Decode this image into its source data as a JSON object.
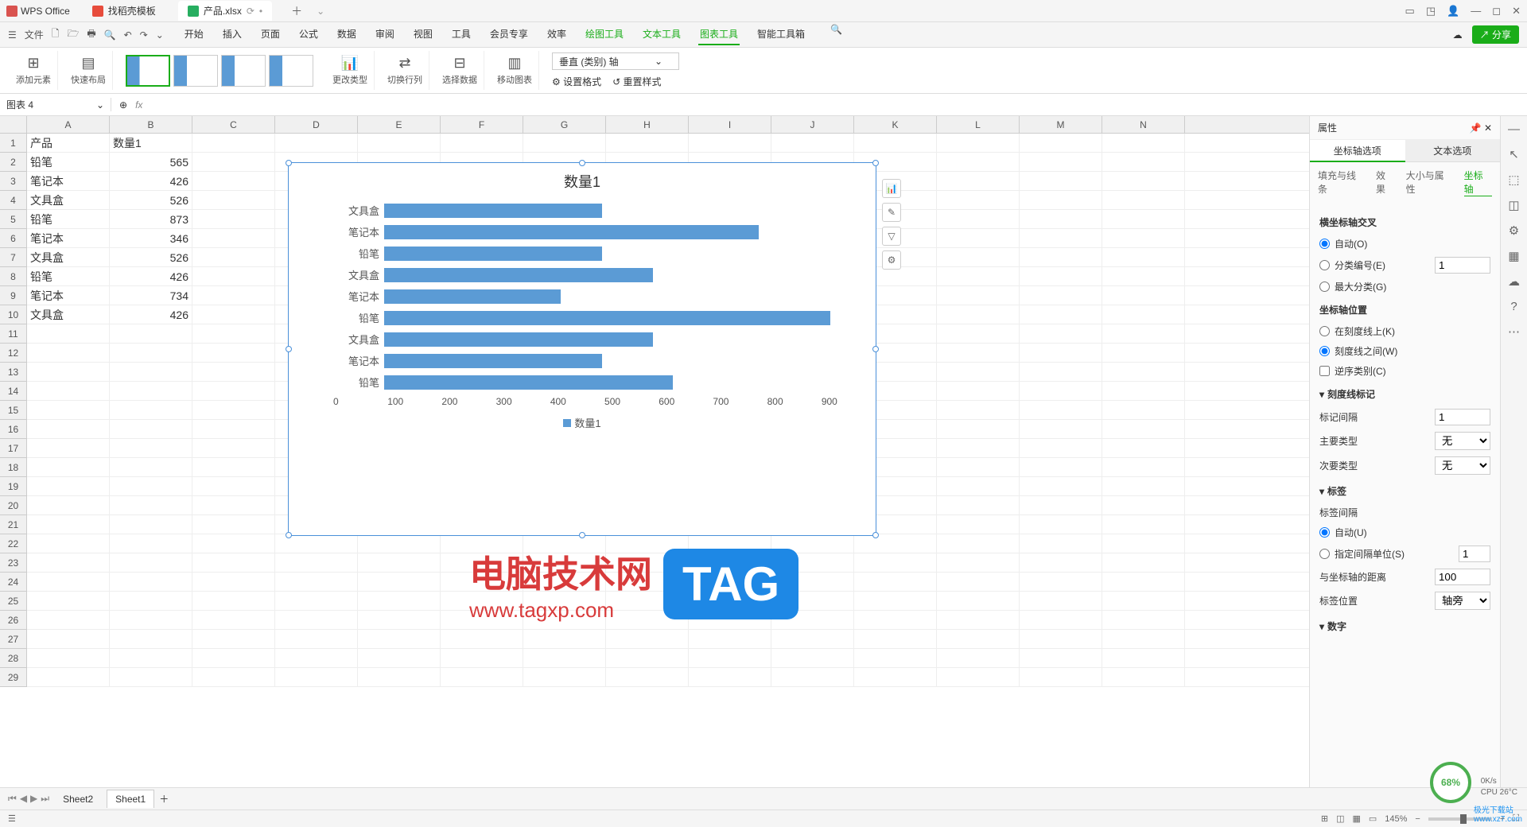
{
  "app": {
    "name": "WPS Office"
  },
  "tabs": [
    {
      "label": "找稻壳模板",
      "type": "template"
    },
    {
      "label": "产品.xlsx",
      "type": "file"
    }
  ],
  "menubar": {
    "file": "文件",
    "items": [
      "开始",
      "插入",
      "页面",
      "公式",
      "数据",
      "审阅",
      "视图",
      "工具",
      "会员专享",
      "效率"
    ],
    "context_items": [
      "绘图工具",
      "文本工具",
      "图表工具",
      "智能工具箱"
    ],
    "active": "图表工具",
    "share": "分享"
  },
  "ribbon": {
    "add_element": "添加元素",
    "quick_layout": "快速布局",
    "change_type": "更改类型",
    "switch_rc": "切换行列",
    "select_data": "选择数据",
    "move_chart": "移动图表",
    "axis_select": "垂直 (类别) 轴",
    "set_format": "设置格式",
    "reset_style": "重置样式"
  },
  "name_box": "图表 4",
  "columns": [
    "A",
    "B",
    "C",
    "D",
    "E",
    "F",
    "G",
    "H",
    "I",
    "J",
    "K",
    "L",
    "M",
    "N"
  ],
  "sheet": {
    "header": {
      "A": "产品",
      "B": "数量1"
    },
    "rows": [
      {
        "A": "铅笔",
        "B": 565
      },
      {
        "A": "笔记本",
        "B": 426
      },
      {
        "A": "文具盒",
        "B": 526
      },
      {
        "A": "铅笔",
        "B": 873
      },
      {
        "A": "笔记本",
        "B": 346
      },
      {
        "A": "文具盒",
        "B": 526
      },
      {
        "A": "铅笔",
        "B": 426
      },
      {
        "A": "笔记本",
        "B": 734
      },
      {
        "A": "文具盒",
        "B": 426
      }
    ],
    "total_rows": 29
  },
  "chart_data": {
    "type": "bar",
    "title": "数量1",
    "categories": [
      "文具盒",
      "笔记本",
      "铅笔",
      "文具盒",
      "笔记本",
      "铅笔",
      "文具盒",
      "笔记本",
      "铅笔"
    ],
    "values": [
      426,
      734,
      426,
      526,
      346,
      873,
      526,
      426,
      565
    ],
    "series_name": "数量1",
    "xlabel": "",
    "ylabel": "",
    "xlim": [
      0,
      900
    ],
    "x_ticks": [
      0,
      100,
      200,
      300,
      400,
      500,
      600,
      700,
      800,
      900
    ],
    "legend": "数量1"
  },
  "props": {
    "title": "属性",
    "main_tabs": [
      "坐标轴选项",
      "文本选项"
    ],
    "sub_tabs": [
      "填充与线条",
      "效果",
      "大小与属性",
      "坐标轴"
    ],
    "section_cross": {
      "title": "横坐标轴交叉",
      "auto": "自动(O)",
      "category_no": "分类编号(E)",
      "category_no_val": "1",
      "max_category": "最大分类(G)"
    },
    "section_axis_pos": {
      "title": "坐标轴位置",
      "on_tick": "在刻度线上(K)",
      "between_tick": "刻度线之间(W)",
      "reverse": "逆序类别(C)"
    },
    "section_tick": {
      "title": "刻度线标记",
      "interval_label": "标记间隔",
      "interval_val": "1",
      "major_label": "主要类型",
      "major_val": "无",
      "minor_label": "次要类型",
      "minor_val": "无"
    },
    "section_label": {
      "title": "标签",
      "label_interval": "标签间隔",
      "auto": "自动(U)",
      "specify": "指定间隔单位(S)",
      "specify_val": "1",
      "distance_label": "与坐标轴的距离",
      "distance_val": "100",
      "position_label": "标签位置",
      "position_val": "轴旁"
    },
    "section_number": {
      "title": "数字"
    }
  },
  "sheets": {
    "nav": [
      "Sheet2",
      "Sheet1"
    ],
    "active": "Sheet1"
  },
  "status": {
    "zoom": "145%"
  },
  "perf": {
    "percent": "68%",
    "net": "0K/s",
    "cpu": "CPU 26°C"
  },
  "watermark": {
    "text": "电脑技术网",
    "sub": "www.tagxp.com",
    "tag": "TAG"
  },
  "download_site": {
    "name": "极光下载站",
    "url": "www.xz7.com"
  }
}
